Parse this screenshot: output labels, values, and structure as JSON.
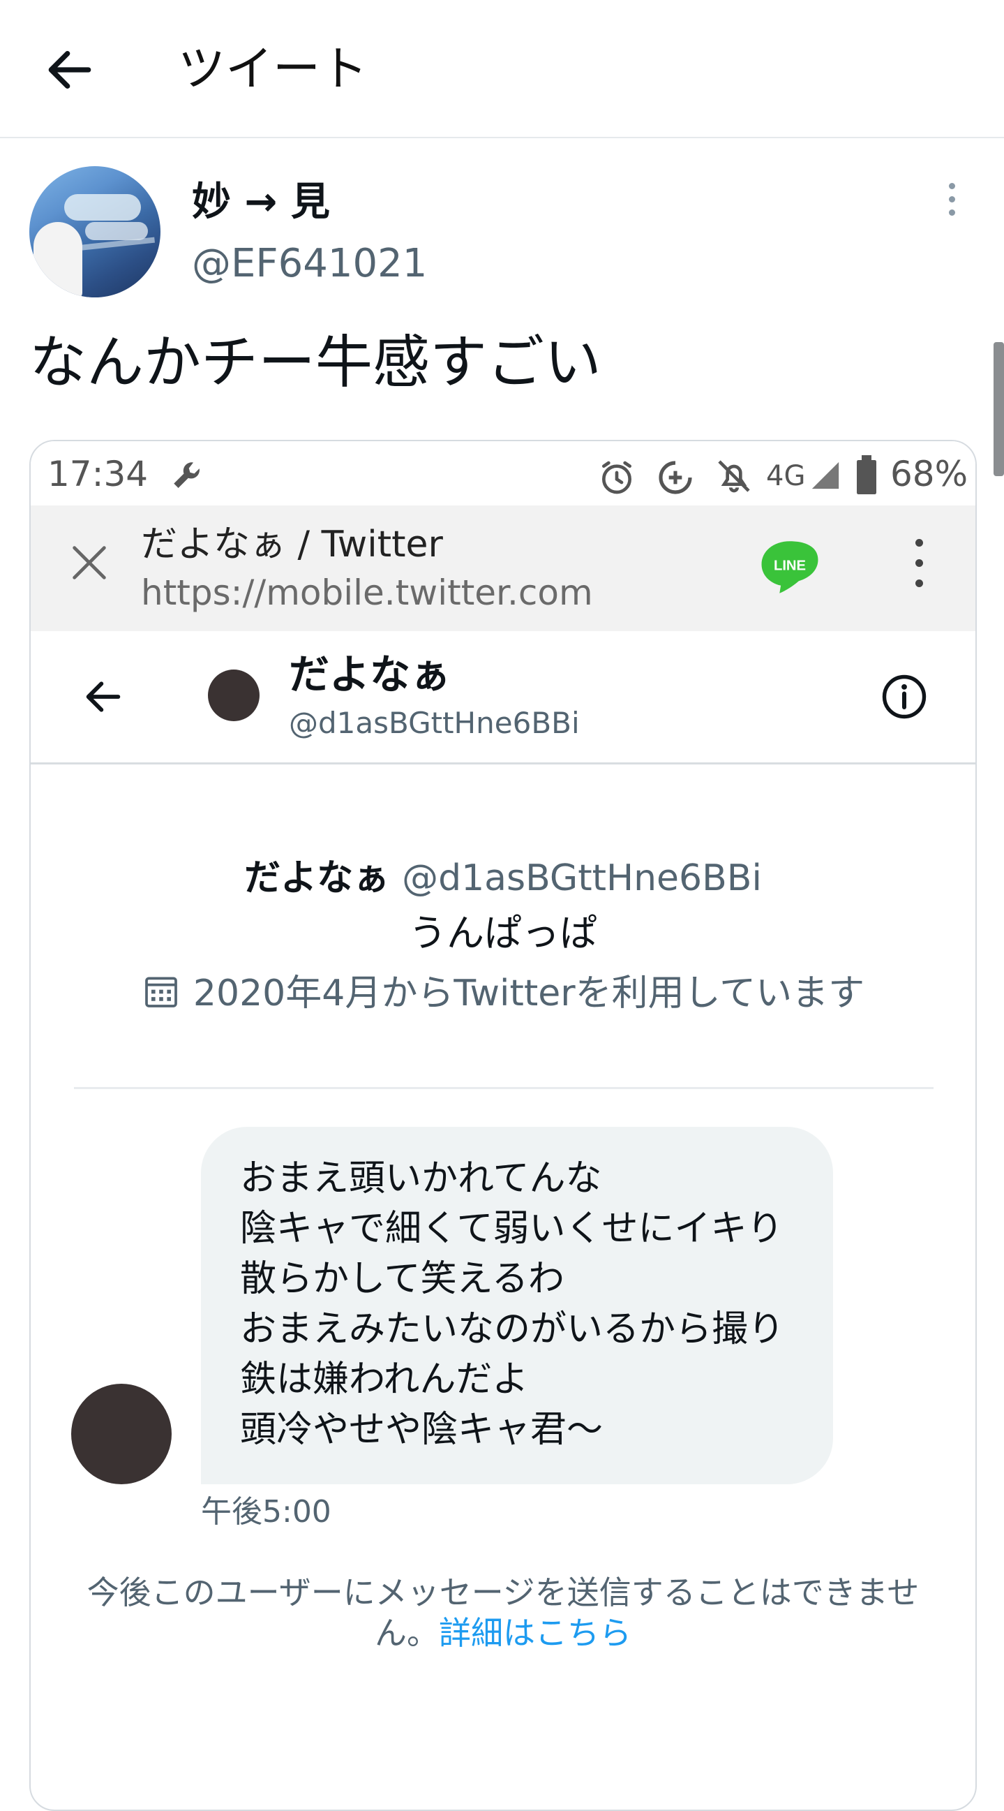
{
  "header": {
    "title": "ツイート"
  },
  "tweet": {
    "display_name": "妙 → 見",
    "handle": "@EF641021",
    "text": "なんかチー牛感すごい"
  },
  "embedded": {
    "status_bar": {
      "time": "17:34",
      "network": "4G",
      "battery": "68%"
    },
    "browser": {
      "title": "だよなぁ / Twitter",
      "url": "https://mobile.twitter.com",
      "line_logo_text": "LINE"
    },
    "dm_header": {
      "name": "だよなぁ",
      "handle": "@d1asBGttHne6BBi"
    },
    "profile": {
      "name": "だよなぁ",
      "handle": "@d1asBGttHne6BBi",
      "bio": "うんぱっぱ",
      "joined": "2020年4月からTwitterを利用しています"
    },
    "message": {
      "lines": [
        "おまえ頭いかれてんな",
        "陰キャで細くて弱いくせにイキり",
        "散らかして笑えるわ",
        "おまえみたいなのがいるから撮り",
        "鉄は嫌われんだよ",
        "頭冷やせや陰キャ君～"
      ],
      "time": "午後5:00"
    },
    "notice": {
      "text_line1": "今後このユーザーにメッセージを送信することはできませ",
      "text_line2": "ん。",
      "link": "詳細はこちら"
    }
  },
  "colors": {
    "link": "#1d9bf0",
    "line_green": "#3ac33a",
    "secondary_text": "#536471",
    "bubble": "#eff3f4"
  },
  "icons": [
    "arrow-left-icon",
    "more-vertical-icon",
    "wrench-icon",
    "alarm-icon",
    "data-saver-icon",
    "notifications-off-icon",
    "signal-icon",
    "battery-icon",
    "close-icon",
    "line-logo-icon",
    "info-icon",
    "calendar-icon"
  ]
}
